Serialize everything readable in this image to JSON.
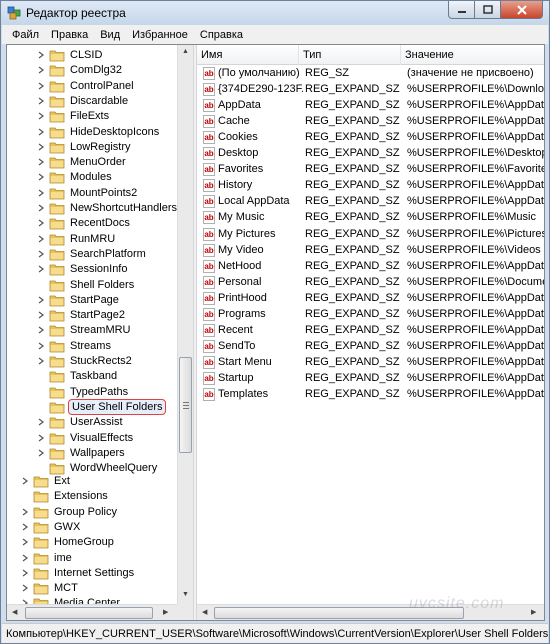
{
  "window": {
    "title": "Редактор реестра"
  },
  "menu": [
    "Файл",
    "Правка",
    "Вид",
    "Избранное",
    "Справка"
  ],
  "tree": {
    "children_items": [
      {
        "label": "CLSID",
        "expandable": true
      },
      {
        "label": "ComDlg32",
        "expandable": true
      },
      {
        "label": "ControlPanel",
        "expandable": true
      },
      {
        "label": "Discardable",
        "expandable": true
      },
      {
        "label": "FileExts",
        "expandable": true
      },
      {
        "label": "HideDesktopIcons",
        "expandable": true
      },
      {
        "label": "LowRegistry",
        "expandable": true
      },
      {
        "label": "MenuOrder",
        "expandable": true
      },
      {
        "label": "Modules",
        "expandable": true
      },
      {
        "label": "MountPoints2",
        "expandable": true
      },
      {
        "label": "NewShortcutHandlers",
        "expandable": true
      },
      {
        "label": "RecentDocs",
        "expandable": true
      },
      {
        "label": "RunMRU",
        "expandable": true
      },
      {
        "label": "SearchPlatform",
        "expandable": true
      },
      {
        "label": "SessionInfo",
        "expandable": true
      },
      {
        "label": "Shell Folders",
        "expandable": false
      },
      {
        "label": "StartPage",
        "expandable": true
      },
      {
        "label": "StartPage2",
        "expandable": true
      },
      {
        "label": "StreamMRU",
        "expandable": true
      },
      {
        "label": "Streams",
        "expandable": true
      },
      {
        "label": "StuckRects2",
        "expandable": true
      },
      {
        "label": "Taskband",
        "expandable": false
      },
      {
        "label": "TypedPaths",
        "expandable": false
      },
      {
        "label": "User Shell Folders",
        "expandable": false,
        "selected": true
      },
      {
        "label": "UserAssist",
        "expandable": true
      },
      {
        "label": "VisualEffects",
        "expandable": true
      },
      {
        "label": "Wallpapers",
        "expandable": true
      },
      {
        "label": "WordWheelQuery",
        "expandable": false
      }
    ],
    "top_items": [
      {
        "label": "Ext",
        "expandable": true
      },
      {
        "label": "Extensions",
        "expandable": false
      },
      {
        "label": "Group Policy",
        "expandable": true
      },
      {
        "label": "GWX",
        "expandable": true
      },
      {
        "label": "HomeGroup",
        "expandable": true
      },
      {
        "label": "ime",
        "expandable": true
      },
      {
        "label": "Internet Settings",
        "expandable": true
      },
      {
        "label": "MCT",
        "expandable": true
      },
      {
        "label": "Media Center",
        "expandable": true
      }
    ]
  },
  "list": {
    "columns": {
      "name": "Имя",
      "type": "Тип",
      "value": "Значение"
    },
    "rows": [
      {
        "name": "(По умолчанию)",
        "type": "REG_SZ",
        "value": "(значение не присвоено)"
      },
      {
        "name": "{374DE290-123F...",
        "type": "REG_EXPAND_SZ",
        "value": "%USERPROFILE%\\Downloads"
      },
      {
        "name": "AppData",
        "type": "REG_EXPAND_SZ",
        "value": "%USERPROFILE%\\AppData\\Roa"
      },
      {
        "name": "Cache",
        "type": "REG_EXPAND_SZ",
        "value": "%USERPROFILE%\\AppData\\Loc"
      },
      {
        "name": "Cookies",
        "type": "REG_EXPAND_SZ",
        "value": "%USERPROFILE%\\AppData\\Roa"
      },
      {
        "name": "Desktop",
        "type": "REG_EXPAND_SZ",
        "value": "%USERPROFILE%\\Desktop"
      },
      {
        "name": "Favorites",
        "type": "REG_EXPAND_SZ",
        "value": "%USERPROFILE%\\Favorites"
      },
      {
        "name": "History",
        "type": "REG_EXPAND_SZ",
        "value": "%USERPROFILE%\\AppData\\Loc"
      },
      {
        "name": "Local AppData",
        "type": "REG_EXPAND_SZ",
        "value": "%USERPROFILE%\\AppData\\Loc"
      },
      {
        "name": "My Music",
        "type": "REG_EXPAND_SZ",
        "value": "%USERPROFILE%\\Music"
      },
      {
        "name": "My Pictures",
        "type": "REG_EXPAND_SZ",
        "value": "%USERPROFILE%\\Pictures"
      },
      {
        "name": "My Video",
        "type": "REG_EXPAND_SZ",
        "value": "%USERPROFILE%\\Videos"
      },
      {
        "name": "NetHood",
        "type": "REG_EXPAND_SZ",
        "value": "%USERPROFILE%\\AppData\\Roa"
      },
      {
        "name": "Personal",
        "type": "REG_EXPAND_SZ",
        "value": "%USERPROFILE%\\Documents"
      },
      {
        "name": "PrintHood",
        "type": "REG_EXPAND_SZ",
        "value": "%USERPROFILE%\\AppData\\Roa"
      },
      {
        "name": "Programs",
        "type": "REG_EXPAND_SZ",
        "value": "%USERPROFILE%\\AppData\\Roa"
      },
      {
        "name": "Recent",
        "type": "REG_EXPAND_SZ",
        "value": "%USERPROFILE%\\AppData\\Roa"
      },
      {
        "name": "SendTo",
        "type": "REG_EXPAND_SZ",
        "value": "%USERPROFILE%\\AppData\\Roa"
      },
      {
        "name": "Start Menu",
        "type": "REG_EXPAND_SZ",
        "value": "%USERPROFILE%\\AppData\\Roa"
      },
      {
        "name": "Startup",
        "type": "REG_EXPAND_SZ",
        "value": "%USERPROFILE%\\AppData\\Roa"
      },
      {
        "name": "Templates",
        "type": "REG_EXPAND_SZ",
        "value": "%USERPROFILE%\\AppData\\Roa"
      }
    ]
  },
  "status": {
    "path": "Компьютер\\HKEY_CURRENT_USER\\Software\\Microsoft\\Windows\\CurrentVersion\\Explorer\\User Shell Folders"
  },
  "watermark": "uvcsite.com",
  "icons": {
    "app": "registry-editor-icon",
    "folder": "folder-icon",
    "value": "string-value-icon",
    "expand": "expand-arrow-icon"
  },
  "colors": {
    "folder": "#e8c25a",
    "selection_outline": "#e04040",
    "value_icon": "#c00000"
  }
}
